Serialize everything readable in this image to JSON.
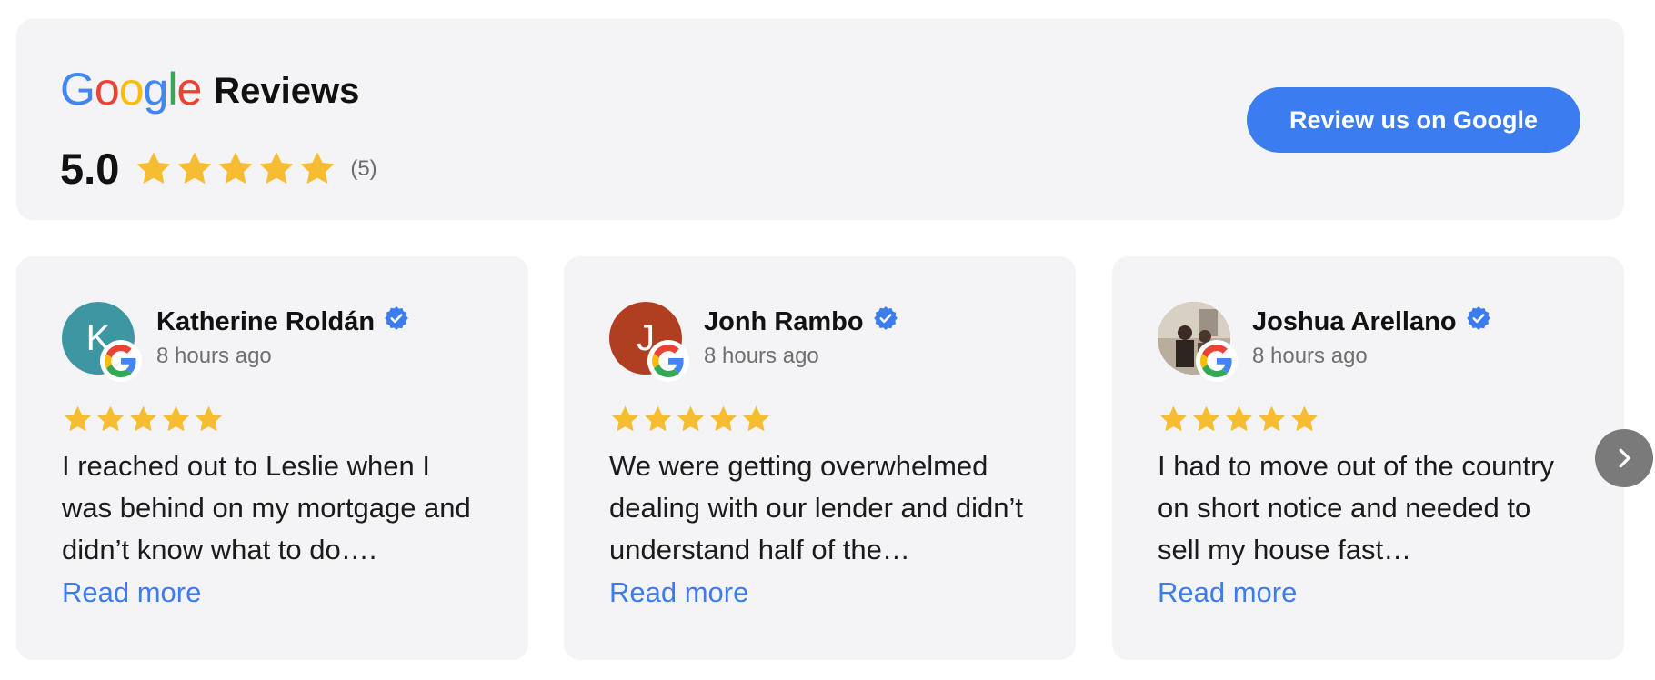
{
  "header": {
    "google_logo_letters": [
      "G",
      "o",
      "o",
      "g",
      "l",
      "e"
    ],
    "google_logo_colors": [
      "#4285F4",
      "#EA4335",
      "#FBBC05",
      "#4285F4",
      "#34A853",
      "#EA4335"
    ],
    "title": "Reviews",
    "rating_value": "5.0",
    "rating_stars": 5,
    "review_count": "(5)",
    "cta_label": "Review us on Google"
  },
  "colors": {
    "star": "#F6BD32",
    "accent": "#3B7DF0",
    "verified": "#3B7DF0",
    "card_bg": "#F4F4F6"
  },
  "reviews": [
    {
      "name": "Katherine Roldán",
      "avatar_initial": "K",
      "avatar_color": "#3E96A3",
      "time": "8 hours ago",
      "stars": 5,
      "text": "I reached out to Leslie when I was behind on my mortgage and didn’t know what to do….",
      "read_more": "Read more"
    },
    {
      "name": "Jonh Rambo",
      "avatar_initial": "J",
      "avatar_color": "#B03F22",
      "time": "8 hours ago",
      "stars": 5,
      "text": "We were getting overwhelmed dealing with our lender and didn’t understand half of the…",
      "read_more": "Read more"
    },
    {
      "name": "Joshua Arellano",
      "avatar_initial": "",
      "avatar_color": "#8a7f74",
      "time": "8 hours ago",
      "stars": 5,
      "text": "I had to move out of the country on short notice and needed to sell my house fast…",
      "read_more": "Read more"
    }
  ],
  "icons": {
    "next": "chevron-right-icon",
    "verified": "verified-badge-icon",
    "google": "google-g-icon",
    "star": "star-icon"
  }
}
